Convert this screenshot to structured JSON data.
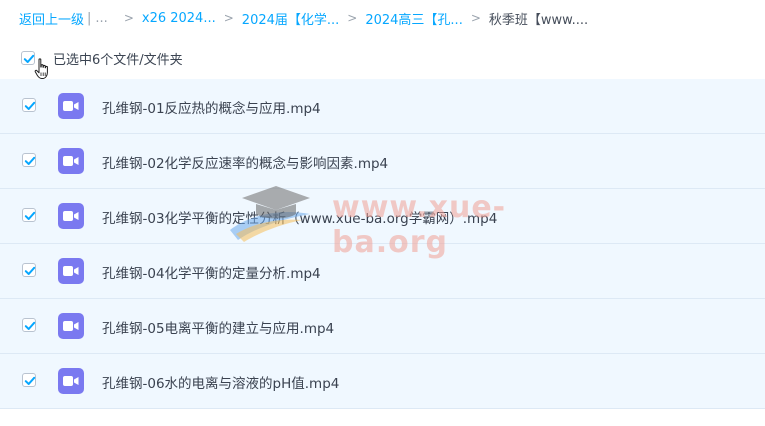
{
  "breadcrumb": {
    "back_label": "返回上一级",
    "separator": "|",
    "ellipsis": "...",
    "arrow": ">",
    "items": [
      "x26 2024...",
      "2024届【化学...",
      "2024高三【孔...",
      "秋季班【www...."
    ]
  },
  "selection": {
    "label": "已选中6个文件/文件夹",
    "checked": true
  },
  "files": [
    {
      "name": "孔维钢-01反应热的概念与应用.mp4",
      "checked": true,
      "icon": "video-file-icon"
    },
    {
      "name": "孔维钢-02化学反应速率的概念与影响因素.mp4",
      "checked": true,
      "icon": "video-file-icon"
    },
    {
      "name": "孔维钢-03化学平衡的定性分析（www.xue-ba.org学霸网）.mp4",
      "checked": true,
      "icon": "video-file-icon"
    },
    {
      "name": "孔维钢-04化学平衡的定量分析.mp4",
      "checked": true,
      "icon": "video-file-icon"
    },
    {
      "name": "孔维钢-05电离平衡的建立与应用.mp4",
      "checked": true,
      "icon": "video-file-icon"
    },
    {
      "name": "孔维钢-06水的电离与溶液的pH值.mp4",
      "checked": true,
      "icon": "video-file-icon"
    }
  ],
  "watermark": {
    "text": "www.xue-ba.org"
  },
  "colors": {
    "link": "#06a7ff",
    "row_selected_bg": "#f0f8ff",
    "check": "#06a7ff",
    "video_icon": "#7a79f0"
  }
}
